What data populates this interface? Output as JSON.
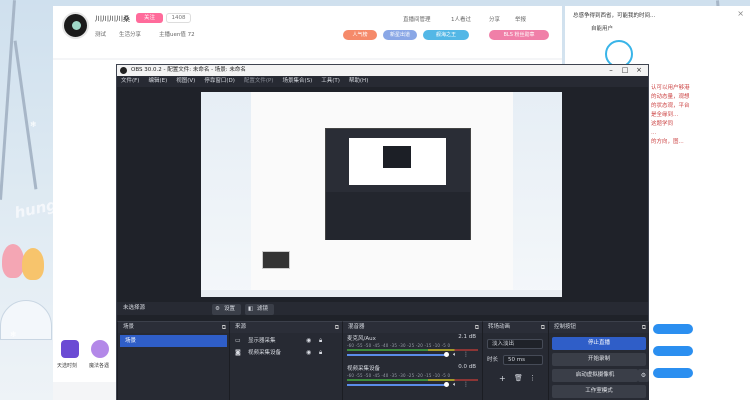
{
  "colors": {
    "obs_bg": "#272a33",
    "accent_blue": "#2f5ec8",
    "follow_pink": "#ff6b9b"
  },
  "room": {
    "streamer_name": "川川川川桑",
    "follow_label": "关注",
    "fans_count": "1408",
    "room_title": "测试",
    "category": "生活分享",
    "host_tag": "主播uen值 72",
    "links": [
      "直播间管理",
      "1人看过",
      "分享",
      "举报"
    ],
    "badges": [
      "人气榜",
      "新星出道",
      "舰海之王",
      "BLS 粉丝勋章"
    ]
  },
  "notice": {
    "title": "总感争得到西省，可能我的时间...",
    "user": "自能用户",
    "snippet_lines": [
      "认可以用户够港",
      "的动态量，观想",
      "的状态观，平台",
      "是全缘到...",
      "这题学同",
      "...",
      "的方向，图..."
    ]
  },
  "gifts": [
    {
      "label": "天选时刻"
    },
    {
      "label": "魔法各遇"
    }
  ],
  "obs": {
    "title": "OBS 30.0.2 - 配置文件: 未命名 - 场景: 未命名",
    "menu": [
      "文件(F)",
      "编辑(E)",
      "视图(V)",
      "停靠窗口(D)",
      "配置文件(P)",
      "场景集合(S)",
      "工具(T)",
      "帮助(H)"
    ],
    "no_source_label": "未选择源",
    "properties_button": "设置",
    "filters_button": "滤镜",
    "docks": {
      "scenes": {
        "title": "场景",
        "items": [
          "场景"
        ]
      },
      "sources": {
        "title": "来源",
        "items": [
          {
            "label": "显示器采集",
            "icon": "monitor-icon"
          },
          {
            "label": "视频采集设备",
            "icon": "camera-icon"
          }
        ]
      },
      "mixer": {
        "title": "混音器",
        "scale": "-60 -55 -50 -45 -40 -35 -30 -25 -20 -15 -10 -5 0",
        "channels": [
          {
            "name": "麦克风/Aux",
            "db": "2.1 dB"
          },
          {
            "name": "视频采集设备",
            "db": "0.0 dB"
          }
        ]
      },
      "transitions": {
        "title": "转场动画",
        "type": "淡入淡出",
        "duration_label": "时长",
        "duration": "50 ms"
      },
      "controls": {
        "title": "控制按钮",
        "buttons": [
          "停止直播",
          "开始录制",
          "启动虚拟摄像机",
          "工作室模式"
        ]
      }
    }
  }
}
